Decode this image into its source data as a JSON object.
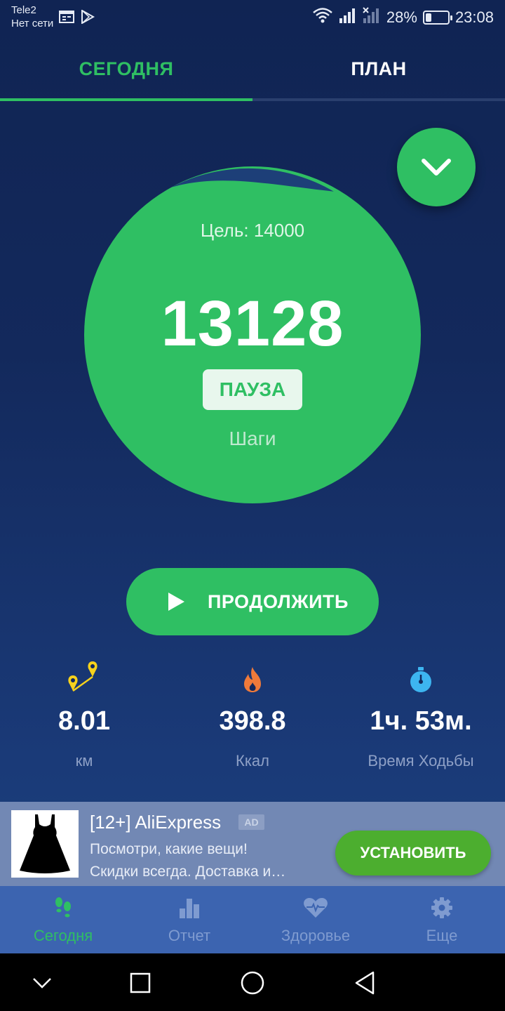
{
  "status_bar": {
    "carrier": "Tele2",
    "network_status": "Нет сети",
    "battery_percent": "28%",
    "battery_level": 0.28,
    "time": "23:08"
  },
  "tabs": [
    {
      "label": "СЕГОДНЯ",
      "active": true
    },
    {
      "label": "ПЛАН",
      "active": false
    }
  ],
  "circle": {
    "goal_text": "Цель: 14000",
    "steps": "13128",
    "pause_label": "ПАУЗА",
    "steps_label": "Шаги",
    "progress_fraction": 0.938
  },
  "continue_button": {
    "label": "ПРОДОЛЖИТЬ"
  },
  "stats": [
    {
      "icon": "map-pins-icon",
      "value": "8.01",
      "label": "км"
    },
    {
      "icon": "flame-icon",
      "value": "398.8",
      "label": "Ккал"
    },
    {
      "icon": "stopwatch-icon",
      "value": "1ч. 53м.",
      "label": "Время Ходьбы"
    }
  ],
  "ad": {
    "title": "[12+] AliExpress",
    "badge": "AD",
    "description_line1": "Посмотри, какие вещи!",
    "description_line2": "Скидки всегда. Доставка и…",
    "install_label": "УСТАНОВИТЬ"
  },
  "bottom_nav": [
    {
      "label": "Сегодня",
      "icon": "footsteps-icon",
      "active": true
    },
    {
      "label": "Отчет",
      "icon": "bar-chart-icon",
      "active": false
    },
    {
      "label": "Здоровье",
      "icon": "heart-pulse-icon",
      "active": false
    },
    {
      "label": "Еще",
      "icon": "gear-icon",
      "active": false
    }
  ],
  "colors": {
    "accent": "#2fbf63",
    "background": "#13295c",
    "nav_bg": "#3c64b0",
    "ad_install": "#4cae2f"
  }
}
